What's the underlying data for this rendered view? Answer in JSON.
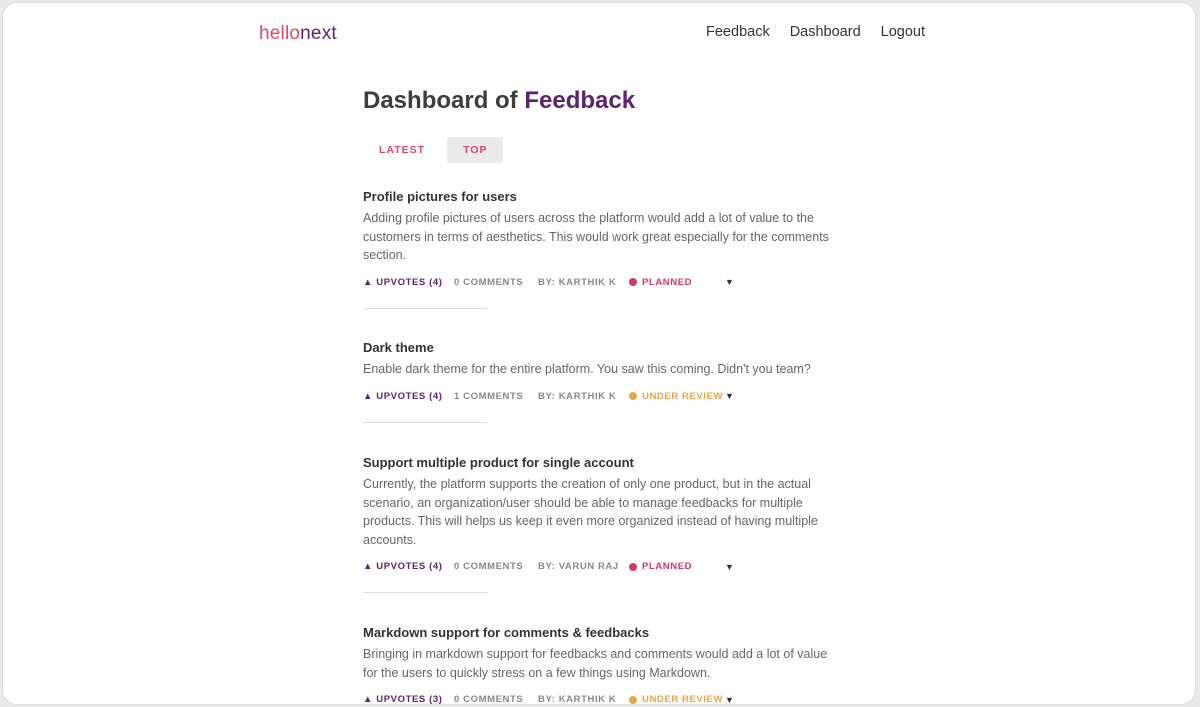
{
  "brand": {
    "hello": "hello",
    "next": "next"
  },
  "nav": {
    "feedback": "Feedback",
    "dashboard": "Dashboard",
    "logout": "Logout"
  },
  "page": {
    "title_prefix": "Dashboard of",
    "title_accent": "Feedback"
  },
  "tabs": [
    {
      "label": "LATEST",
      "active": false
    },
    {
      "label": "TOP",
      "active": true
    }
  ],
  "posts": [
    {
      "title": "Profile pictures for users",
      "description": "Adding profile pictures of users across the platform would add a lot of value to the customers in terms of aesthetics. This would work great especially for the comments section.",
      "upvotes": "▲ UPVOTES (4)",
      "comments": "0 COMMENTS",
      "author": "BY: KARTHIK K",
      "status": "PLANNED"
    },
    {
      "title": "Dark theme",
      "description": "Enable dark theme for the entire platform. You saw this coming. Didn't you team?",
      "upvotes": "▲ UPVOTES (4)",
      "comments": "1 COMMENTS",
      "author": "BY: KARTHIK K",
      "status": "UNDER REVIEW"
    },
    {
      "title": "Support multiple product for single account",
      "description": "Currently, the platform supports the creation of only one product, but in the actual scenario, an organization/user should be able to manage feedbacks for multiple products. This will helps us keep it even more organized instead of having multiple accounts.",
      "upvotes": "▲ UPVOTES (4)",
      "comments": "0 COMMENTS",
      "author": "BY: VARUN RAJ",
      "status": "PLANNED"
    },
    {
      "title": "Markdown support for comments & feedbacks",
      "description": "Bringing in markdown support for feedbacks and comments would add a lot of value for the users to quickly stress on a few things using Markdown.",
      "upvotes": "▲ UPVOTES (3)",
      "comments": "0 COMMENTS",
      "author": "BY: KARTHIK K",
      "status": "UNDER REVIEW"
    }
  ],
  "icons": {
    "status_dropdown": "caret-down-icon",
    "upvote": "triangle-up-icon"
  },
  "colors": {
    "brand_pink": "#e0476b",
    "brand_purple": "#5c2370",
    "planned": "#d2386b",
    "under_review": "#e8a54a"
  }
}
